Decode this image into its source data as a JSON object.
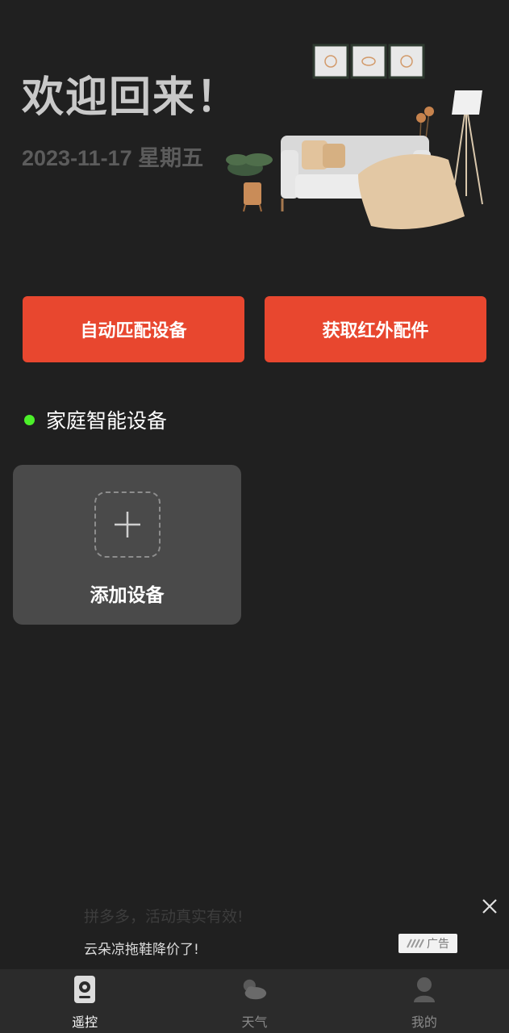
{
  "header": {
    "welcome": "欢迎回来！",
    "date": "2023-11-17 星期五"
  },
  "actions": {
    "auto_match": "自动匹配设备",
    "get_ir_accessory": "获取红外配件"
  },
  "section": {
    "title": "家庭智能设备",
    "dot_color": "#4cf02a"
  },
  "add_device": {
    "label": "添加设备"
  },
  "ad": {
    "title": "拼多多，活动真实有效!",
    "subtitle": "云朵凉拖鞋降价了!",
    "badge": "广告"
  },
  "tabs": [
    {
      "label": "遥控",
      "icon": "remote-icon",
      "active": true
    },
    {
      "label": "天气",
      "icon": "weather-icon",
      "active": false
    },
    {
      "label": "我的",
      "icon": "profile-icon",
      "active": false
    }
  ],
  "colors": {
    "background": "#202020",
    "accent": "#e8472f",
    "card": "#4a4a4a",
    "tabbar": "#2b2b2b"
  }
}
